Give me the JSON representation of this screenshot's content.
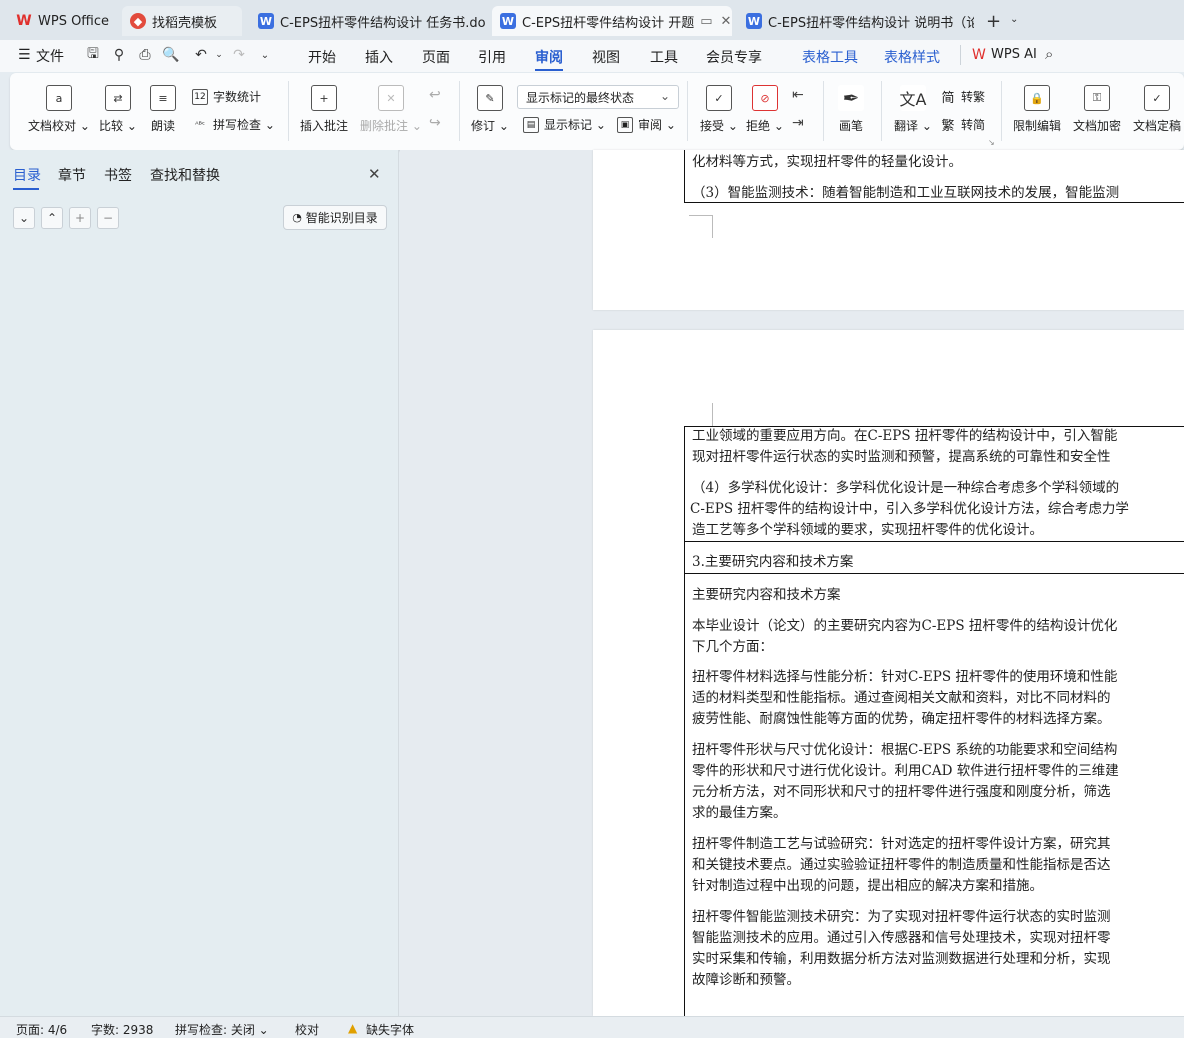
{
  "tabs": [
    {
      "label": "WPS Office",
      "icon": "wps-logo-icon"
    },
    {
      "label": "找稻壳模板",
      "icon": "docer-icon"
    },
    {
      "label": "C-EPS扭杆零件结构设计 任务书.doc",
      "icon": "word-doc-icon"
    },
    {
      "label": "C-EPS扭杆零件结构设计 开题",
      "icon": "word-doc-icon"
    },
    {
      "label": "C-EPS扭杆零件结构设计 说明书（论",
      "icon": "word-doc-icon"
    }
  ],
  "menu": {
    "file": "文件",
    "items": [
      "开始",
      "插入",
      "页面",
      "引用",
      "审阅",
      "视图",
      "工具",
      "会员专享"
    ],
    "context_items": [
      "表格工具",
      "表格样式"
    ],
    "wps_ai": "WPS AI",
    "selected": "审阅"
  },
  "ribbon": {
    "doc_proof": "文档校对",
    "compare": "比较",
    "read_aloud": "朗读",
    "word_count": "字数统计",
    "spell_check": "拼写检查",
    "insert_comment": "插入批注",
    "delete_comment": "删除批注",
    "revise": "修订",
    "markup_state": "显示标记的最终状态",
    "show_markup": "显示标记",
    "review": "审阅",
    "accept": "接受",
    "reject": "拒绝",
    "pen": "画笔",
    "translate": "翻译",
    "to_traditional": "转繁",
    "to_simplified": "转简",
    "restrict_edit": "限制编辑",
    "encrypt": "文档加密",
    "finalize": "文档定稿"
  },
  "nav_pane": {
    "tabs": [
      "目录",
      "章节",
      "书签",
      "查找和替换"
    ],
    "selected": "目录",
    "smart_toc": "智能识别目录"
  },
  "document": {
    "page1_lines": [
      "化材料等方式，实现扭杆零件的轻量化设计。",
      "（3）智能监测技术：随着智能制造和工业互联网技术的发展，智能监测"
    ],
    "block1": [
      "工业领域的重要应用方向。在C-EPS 扭杆零件的结构设计中，引入智能",
      "现对扭杆零件运行状态的实时监测和预警，提高系统的可靠性和安全性"
    ],
    "block2": [
      "（4）多学科优化设计：多学科优化设计是一种综合考虑多个学科领域的",
      "C-EPS 扭杆零件的结构设计中，引入多学科优化设计方法，综合考虑力学",
      "造工艺等多个学科领域的要求，实现扭杆零件的优化设计。"
    ],
    "section_title": "3.主要研究内容和技术方案",
    "sub_title": "主要研究内容和技术方案",
    "intro": [
      "本毕业设计（论文）的主要研究内容为C-EPS 扭杆零件的结构设计优化",
      "下几个方面："
    ],
    "para1": [
      "扭杆零件材料选择与性能分析：针对C-EPS 扭杆零件的使用环境和性能",
      "适的材料类型和性能指标。通过查阅相关文献和资料，对比不同材料的",
      "疲劳性能、耐腐蚀性能等方面的优势，确定扭杆零件的材料选择方案。"
    ],
    "para2": [
      "扭杆零件形状与尺寸优化设计：根据C-EPS 系统的功能要求和空间结构",
      "零件的形状和尺寸进行优化设计。利用CAD 软件进行扭杆零件的三维建",
      "元分析方法，对不同形状和尺寸的扭杆零件进行强度和刚度分析，筛选",
      "求的最佳方案。"
    ],
    "para3": [
      "扭杆零件制造工艺与试验研究：针对选定的扭杆零件设计方案，研究其",
      "和关键技术要点。通过实验验证扭杆零件的制造质量和性能指标是否达",
      "针对制造过程中出现的问题，提出相应的解决方案和措施。"
    ],
    "para4": [
      "扭杆零件智能监测技术研究：为了实现对扭杆零件运行状态的实时监测",
      "智能监测技术的应用。通过引入传感器和信号处理技术，实现对扭杆零",
      "实时采集和传输，利用数据分析方法对监测数据进行处理和分析，实现",
      "故障诊断和预警。"
    ]
  },
  "status": {
    "page": "页面: 4/6",
    "words": "字数: 2938",
    "spell": "拼写检查: 关闭",
    "proof": "校对",
    "missing_font": "缺失字体"
  },
  "colors": {
    "accent": "#2a5fd0",
    "word_icon": "#3b6fe0",
    "wps_red": "#e0302d"
  }
}
